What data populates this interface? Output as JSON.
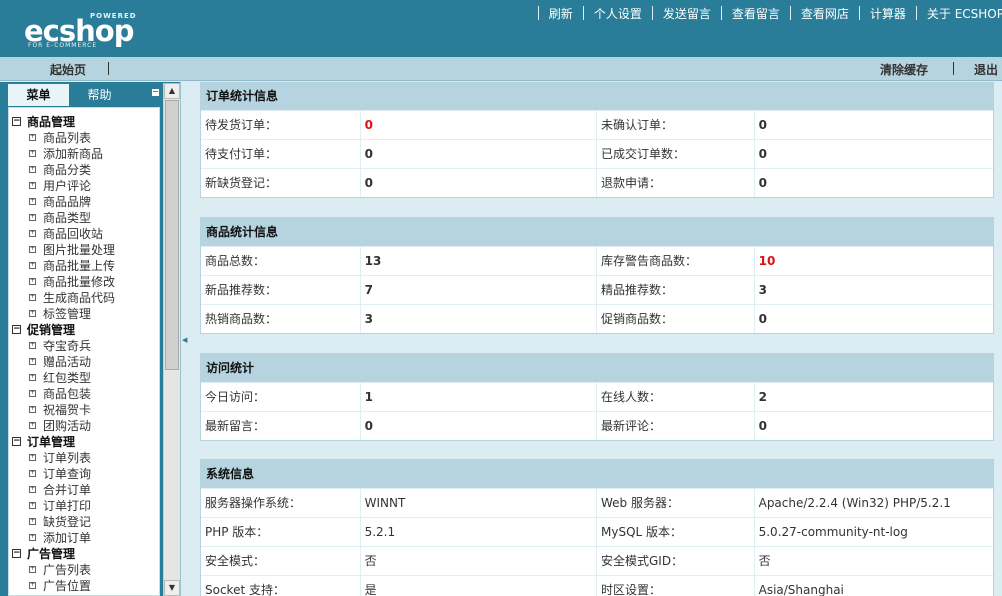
{
  "logo": {
    "powered": "POWERED",
    "brand": "ecshop",
    "sub": "FOR E-COMMERCE"
  },
  "topnav": [
    "刷新",
    "个人设置",
    "发送留言",
    "查看留言",
    "查看网店",
    "计算器",
    "关于 ECSHOP"
  ],
  "subbar": {
    "home": "起始页",
    "clear_cache": "清除缓存",
    "logout": "退出"
  },
  "sidebar": {
    "tabs": [
      "菜单",
      "帮助"
    ],
    "groups": [
      {
        "title": "商品管理",
        "items": [
          "商品列表",
          "添加新商品",
          "商品分类",
          "用户评论",
          "商品品牌",
          "商品类型",
          "商品回收站",
          "图片批量处理",
          "商品批量上传",
          "商品批量修改",
          "生成商品代码",
          "标签管理"
        ]
      },
      {
        "title": "促销管理",
        "items": [
          "夺宝奇兵",
          "赠品活动",
          "红包类型",
          "商品包装",
          "祝福贺卡",
          "团购活动"
        ]
      },
      {
        "title": "订单管理",
        "items": [
          "订单列表",
          "订单查询",
          "合并订单",
          "订单打印",
          "缺货登记",
          "添加订单"
        ]
      },
      {
        "title": "广告管理",
        "items": [
          "广告列表",
          "广告位置"
        ]
      }
    ]
  },
  "panels": {
    "orders": {
      "title": "订单统计信息",
      "rows": [
        [
          "待发货订单：",
          "0",
          "未确认订单：",
          "0"
        ],
        [
          "待支付订单：",
          "0",
          "已成交订单数：",
          "0"
        ],
        [
          "新缺货登记：",
          "0",
          "退款申请：",
          "0"
        ]
      ]
    },
    "goods": {
      "title": "商品统计信息",
      "rows": [
        [
          "商品总数：",
          "13",
          "库存警告商品数：",
          "10"
        ],
        [
          "新品推荐数：",
          "7",
          "精品推荐数：",
          "3"
        ],
        [
          "热销商品数：",
          "3",
          "促销商品数：",
          "0"
        ]
      ]
    },
    "visits": {
      "title": "访问统计",
      "rows": [
        [
          "今日访问：",
          "1",
          "在线人数：",
          "2"
        ],
        [
          "最新留言：",
          "0",
          "最新评论：",
          "0"
        ]
      ]
    },
    "system": {
      "title": "系统信息",
      "rows": [
        [
          "服务器操作系统：",
          "WINNT",
          "Web 服务器：",
          "Apache/2.2.4 (Win32) PHP/5.2.1"
        ],
        [
          "PHP 版本：",
          "5.2.1",
          "MySQL 版本：",
          "5.0.27-community-nt-log"
        ],
        [
          "安全模式：",
          "否",
          "安全模式GID：",
          "否"
        ],
        [
          "Socket 支持：",
          "是",
          "时区设置：",
          "Asia/Shanghai"
        ]
      ]
    }
  },
  "colors": {
    "header": "#2a7d98",
    "panel_title": "#b6d4df",
    "alert": "#e01010"
  }
}
